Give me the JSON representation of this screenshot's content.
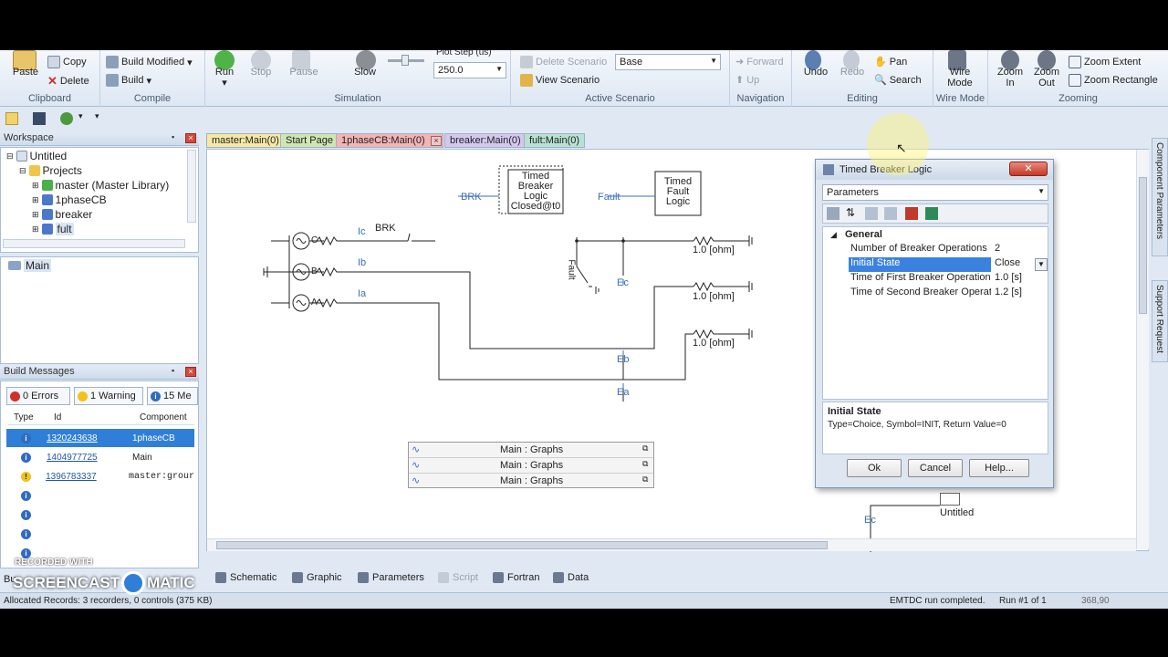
{
  "ribbon": {
    "clipboard": {
      "label": "Clipboard",
      "paste": "Paste",
      "copy": "Copy",
      "delete": "Delete"
    },
    "compile": {
      "label": "Compile",
      "build_modified": "Build Modified",
      "build": "Build"
    },
    "simulation": {
      "label": "Simulation",
      "run": "Run",
      "stop": "Stop",
      "pause": "Pause",
      "slow": "Slow",
      "plot_step_label": "Plot Step (us)",
      "plot_step_value": "250.0"
    },
    "active_scenario": {
      "label": "Active Scenario",
      "delete_scenario": "Delete Scenario",
      "view_scenario": "View Scenario",
      "scenario_value": "Base"
    },
    "navigation": {
      "label": "Navigation",
      "forward": "Forward",
      "up": "Up"
    },
    "editing": {
      "label": "Editing",
      "undo": "Undo",
      "redo": "Redo",
      "pan": "Pan",
      "search": "Search"
    },
    "wire_mode": {
      "label": "Wire Mode",
      "wire_mode": "Wire\nMode"
    },
    "zooming": {
      "label": "Zooming",
      "zoom_in": "Zoom\nIn",
      "zoom_out": "Zoom\nOut",
      "zoom_extent": "Zoom Extent",
      "zoom_rectangle": "Zoom Rectangle"
    }
  },
  "workspace": {
    "title": "Workspace",
    "tree": [
      "Untitled",
      "Projects",
      "master (Master Library)",
      "1phaseCB",
      "breaker",
      "fult"
    ],
    "definitions": [
      "Main"
    ]
  },
  "build_messages": {
    "title": "Build Messages",
    "errors": "0 Errors",
    "warnings": "1 Warning",
    "messages": "15 Me",
    "columns": [
      "Type",
      "Id",
      "Component"
    ],
    "rows": [
      {
        "id": "1320243638",
        "component": "1phaseCB"
      },
      {
        "id": "1404977725",
        "component": "Main"
      },
      {
        "id": "1396783337",
        "component": "master:grour"
      }
    ],
    "bottom_tab": "Bu"
  },
  "doc_tabs": [
    "master:Main(0)",
    "Start Page",
    "1phaseCB:Main(0)",
    "breaker:Main(0)",
    "fult:Main(0)"
  ],
  "canvas": {
    "timed_breaker_lines": [
      "Timed",
      "Breaker",
      "Logic",
      "Closed@t0"
    ],
    "timed_fault_lines": [
      "Timed",
      "Fault",
      "Logic"
    ],
    "brk_signal": "BRK",
    "fault_signal": "Fault",
    "brk_label": "BRK",
    "phases": [
      "C",
      "B",
      "A"
    ],
    "currents": [
      "Ic",
      "Ib",
      "Ia"
    ],
    "resistors": [
      "1.0 [ohm]",
      "1.0 [ohm]",
      "1.0 [ohm]"
    ],
    "fault_label": "Fault",
    "voltages": [
      "Ec",
      "Eb",
      "Ea",
      "Ec"
    ],
    "graphs": [
      "Main : Graphs",
      "Main : Graphs",
      "Main : Graphs"
    ],
    "untitled": "Untitled"
  },
  "bottom_tabs": [
    "Schematic",
    "Graphic",
    "Parameters",
    "Script",
    "Fortran",
    "Data"
  ],
  "right_side": [
    "Component Parameters",
    "Support Request"
  ],
  "dialog": {
    "title": "Timed Breaker Logic",
    "category": "Parameters",
    "section": "General",
    "params": [
      {
        "k": "Number of Breaker Operations",
        "v": "2"
      },
      {
        "k": "Initial State",
        "v": "Close"
      },
      {
        "k": "Time of First Breaker Operation",
        "v": "1.0 [s]"
      },
      {
        "k": "Time of Second Breaker Operatic",
        "v": "1.2 [s]"
      }
    ],
    "desc_title": "Initial State",
    "desc_text": "Type=Choice, Symbol=INIT, Return Value=0",
    "ok": "Ok",
    "cancel": "Cancel",
    "help": "Help..."
  },
  "status": {
    "left": "Allocated Records: 3 recorders, 0 controls (375 KB)",
    "right": "EMTDC run completed.",
    "run": "Run #1 of 1",
    "coords": "368,90"
  },
  "watermark": {
    "line1": "RECORDED WITH",
    "line2": "SCREENCAST",
    "line3": "MATIC"
  }
}
